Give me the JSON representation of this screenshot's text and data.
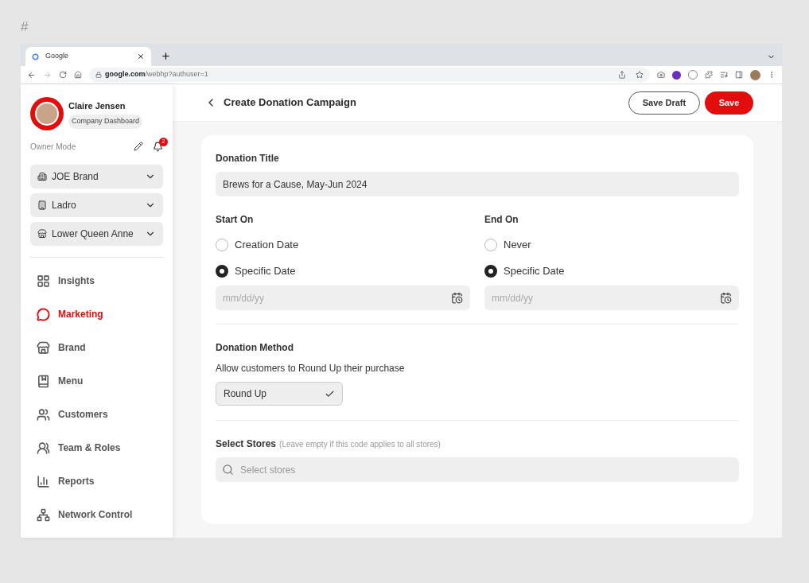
{
  "page_mark": "#",
  "browser": {
    "tab_title": "Google",
    "url_host": "google.com",
    "url_path": "/webhp?authuser=1"
  },
  "profile": {
    "name": "Claire Jensen",
    "role": "Company Dashboard",
    "mode": "Owner Mode",
    "notifications": "2"
  },
  "scopes": [
    {
      "kind": "company",
      "label": "JOE Brand"
    },
    {
      "kind": "brand",
      "label": "Ladro"
    },
    {
      "kind": "store",
      "label": "Lower Queen Anne"
    }
  ],
  "nav": [
    {
      "kind": "insights",
      "label": "Insights",
      "selected": false
    },
    {
      "kind": "marketing",
      "label": "Marketing",
      "selected": true
    },
    {
      "kind": "brand",
      "label": "Brand",
      "selected": false
    },
    {
      "kind": "menu",
      "label": "Menu",
      "selected": false
    },
    {
      "kind": "customers",
      "label": "Customers",
      "selected": false
    },
    {
      "kind": "team",
      "label": "Team & Roles",
      "selected": false
    },
    {
      "kind": "reports",
      "label": "Reports",
      "selected": false
    },
    {
      "kind": "network",
      "label": "Network Control",
      "selected": false
    }
  ],
  "header": {
    "title": "Create Donation Campaign",
    "buttons": [
      {
        "kind": "secondary",
        "label": "Save Draft"
      },
      {
        "kind": "primary",
        "label": "Save"
      }
    ]
  },
  "form": {
    "title_label": "Donation Title",
    "title_value": "Brews for a Cause, May-Jun 2024",
    "schedule": [
      {
        "label": "Start On",
        "options": [
          {
            "label": "Creation Date",
            "selected": false
          },
          {
            "label": "Specific Date",
            "selected": true
          }
        ],
        "date_placeholder": "mm/dd/yy"
      },
      {
        "label": "End On",
        "options": [
          {
            "label": "Never",
            "selected": false
          },
          {
            "label": "Specific Date",
            "selected": true
          }
        ],
        "date_placeholder": "mm/dd/yy"
      }
    ],
    "method_label": "Donation Method",
    "method_hint": "Allow customers to Round Up their purchase",
    "methods": [
      {
        "label": "Round Up",
        "selected": true
      }
    ],
    "stores_label": "Select Stores",
    "stores_hint": "(Leave empty if this code applies to all stores)",
    "stores_placeholder": "Select stores"
  }
}
